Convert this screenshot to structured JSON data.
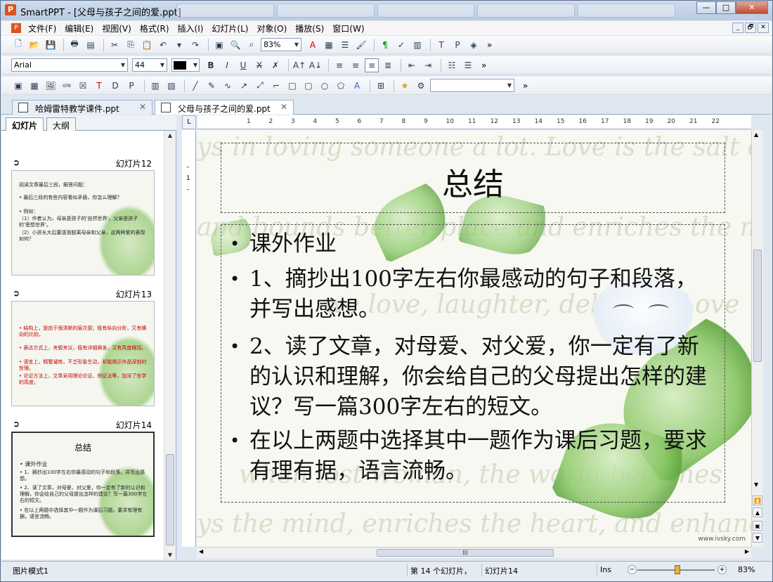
{
  "window": {
    "title": "SmartPPT - [父母与孩子之间的爱.ppt]",
    "app_icon": "P",
    "buttons": {
      "minimize": "—",
      "maximize": "□",
      "close": "✕"
    }
  },
  "menu": {
    "items": [
      "文件(F)",
      "编辑(E)",
      "视图(V)",
      "格式(R)",
      "插入(I)",
      "幻灯片(L)",
      "对象(O)",
      "播放(S)",
      "窗口(W)"
    ],
    "mdi": {
      "minimize": "_",
      "restore": "🗗",
      "close": "✕"
    }
  },
  "toolbar1": {
    "zoom_value": "83%",
    "more": "»"
  },
  "toolbar2": {
    "font_name": "Arial",
    "font_size": "44",
    "more": "»"
  },
  "toolbar3": {
    "shape_select_value": "",
    "more": "»"
  },
  "doc_tabs": [
    {
      "label": "哈姆雷特教学课件.ppt",
      "close": "✕"
    },
    {
      "label": "父母与孩子之间的爱.ppt",
      "close": "✕"
    }
  ],
  "left_pane": {
    "tabs": [
      "幻灯片",
      "大纲"
    ],
    "slides": [
      {
        "number_label": "幻灯片12",
        "lines": [
          "阅读文章最后三段，解答问题：",
          "• 最后三段的有些内容看似矛盾，你怎么理解？",
          "• 例如：",
          "（1）作者认为，母亲是孩子的'自然世界'，父亲是孩子的'思想世界'。",
          "（2）小孩长大后要逐渐脱离母亲和父亲，这两种爱的表现如何？"
        ]
      },
      {
        "number_label": "幻灯片13",
        "lines": [
          "• 结构上，是由于很清晰的层次感；既有纵向分析，又有横向的比较。",
          "• 表达方式上，夹叙夹议，既有详细阐发，又有高度概括。",
          "• 语言上，精警凝练，不乏形象生动，却能揭示作品深刻的哲理。",
          "• 论证方法上，文章采用理论论证、例证法等，加深了哲学的高度。"
        ]
      },
      {
        "number_label": "幻灯片14",
        "title": "总结",
        "lines": [
          "• 课外作业",
          "• 1、摘抄出100字左右你最感动的句子和段落，并写出感想。",
          "• 2、读了文章，对母爱、对父爱，你一定有了新的认识和理解，你会给自己的父母提出怎样的建议？写一篇300字左右的短文。",
          "• 在以上两题中选择其中一题作为课后习题，要求有理有据，语言流畅。"
        ]
      }
    ],
    "arrow_icon": "➲"
  },
  "ruler": {
    "corner": "L",
    "ticks": [
      "1",
      "2",
      "3",
      "4",
      "5",
      "6",
      "7",
      "8",
      "9",
      "10",
      "11",
      "12",
      "13",
      "14",
      "15",
      "16",
      "17",
      "18",
      "19",
      "20",
      "21",
      "22"
    ]
  },
  "slide": {
    "title": "总结",
    "bullets": [
      "课外作业",
      "1、摘抄出100字左右你最感动的句子和段落，并写出感想。",
      "2、读了文章，对母爱、对父爱，你一定有了新的认识和理解，你会给自己的父母提出怎样的建议？写一篇300字左右的短文。",
      "在以上两题中选择其中一题作为课后习题，要求有理有据，语言流畅。"
    ],
    "bullet_glyph": "•",
    "background_text": [
      "ys in loving someone a lot. Love is the salt of",
      "and bounds better place and enriches the mind,",
      "we love, laughter, delights. Love",
      "when lost woman, the world becomes",
      "ys the mind, enriches the heart, and enhances"
    ],
    "watermark": "www.ivsky.com"
  },
  "status": {
    "mode": "图片模式1",
    "slide_count": "第 14 个幻灯片，",
    "current_slide": "幻灯片14",
    "ins": "Ins",
    "zoom": "83%"
  }
}
